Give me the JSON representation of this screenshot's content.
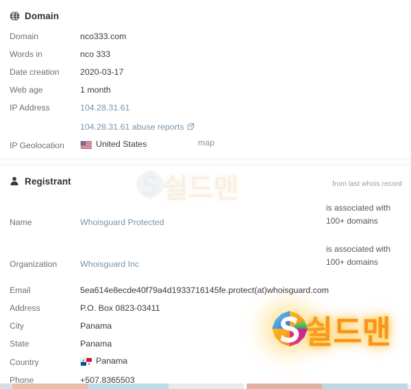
{
  "domain_section": {
    "icon": "globe-icon",
    "title": "Domain",
    "rows": [
      {
        "label": "Domain",
        "value": "nco333.com",
        "type": "text"
      },
      {
        "label": "Words in",
        "value": "nco 333",
        "type": "text"
      },
      {
        "label": "Date creation",
        "value": "2020-03-17",
        "type": "text"
      },
      {
        "label": "Web age",
        "value": "1 month",
        "type": "text"
      },
      {
        "label": "IP Address",
        "value": "104.28.31.61",
        "type": "link"
      }
    ],
    "abuse_reports": {
      "label": "104.28.31.61 abuse reports",
      "icon": "external-link-icon"
    },
    "geolocation": {
      "label": "IP Geolocation",
      "country": "United States",
      "flag": "us-flag-icon",
      "map_link": "map"
    }
  },
  "registrant_section": {
    "icon": "user-icon",
    "title": "Registrant",
    "source_note": "from last whois record",
    "rows": [
      {
        "label": "Name",
        "value": "Whoisguard Protected",
        "type": "link",
        "note": "is associated with 100+ domains"
      },
      {
        "label": "Organization",
        "value": "Whoisguard Inc",
        "type": "link",
        "note": "is associated with 100+ domains"
      },
      {
        "label": "Email",
        "value": "5ea614e8ecde40f79a4d1933716145fe.protect(at)whoisguard.com",
        "type": "text"
      },
      {
        "label": "Address",
        "value": "P.O. Box 0823-03411",
        "type": "text"
      },
      {
        "label": "City",
        "value": "Panama",
        "type": "text"
      },
      {
        "label": "State",
        "value": "Panama",
        "type": "text"
      },
      {
        "label": "Country",
        "value": "Panama",
        "type": "flag",
        "flag": "panama-flag-icon"
      },
      {
        "label": "Phone",
        "value": "+507.8365503",
        "type": "text"
      }
    ]
  },
  "watermark": {
    "text": "쉴드맨",
    "logo": "shieldman-s-logo",
    "color": "#f79421"
  },
  "colors": {
    "link": "#7b93a8",
    "label": "#6e6e76",
    "value": "#3a3a40",
    "card_border": "#ececf0",
    "note": "#9a9aa2"
  }
}
